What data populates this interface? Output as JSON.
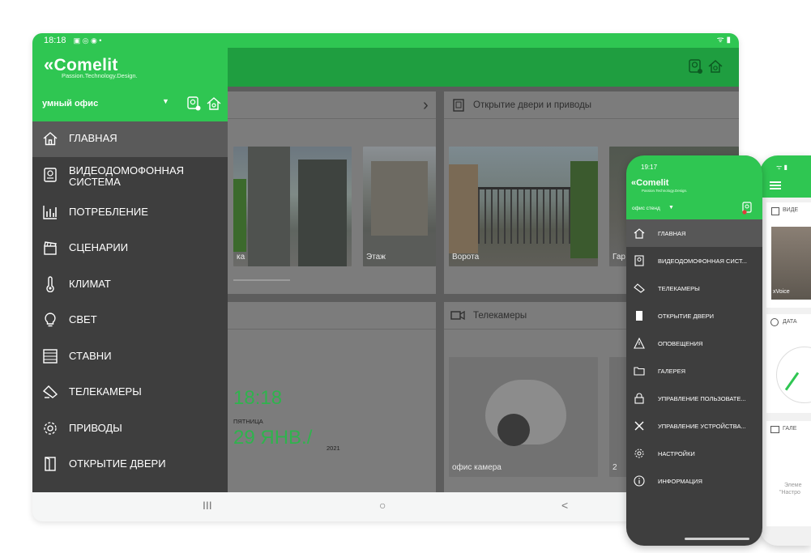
{
  "tablet": {
    "status_time": "18:18",
    "status_icons": "▣ ◎ ◉ •",
    "status_right": "ᯤ ▮",
    "brand": "Comelit",
    "brand_mark": "«",
    "tagline": "Passion.Technology.Design.",
    "office": "умный офис",
    "menu": [
      {
        "label": "ГЛАВНАЯ",
        "icon": "home-icon",
        "active": true
      },
      {
        "label": "ВИДЕОДОМОФОННАЯ СИСТЕМА",
        "icon": "intercom-icon"
      },
      {
        "label": "ПОТРЕБЛЕНИЕ",
        "icon": "chart-icon"
      },
      {
        "label": "СЦЕНАРИИ",
        "icon": "clapperboard-icon"
      },
      {
        "label": "КЛИМАТ",
        "icon": "thermometer-icon"
      },
      {
        "label": "СВЕТ",
        "icon": "bulb-icon"
      },
      {
        "label": "СТАВНИ",
        "icon": "shutter-icon"
      },
      {
        "label": "ТЕЛЕКАМЕРЫ",
        "icon": "camera-icon"
      },
      {
        "label": "ПРИВОДЫ",
        "icon": "gear-icon"
      },
      {
        "label": "ОТКРЫТИЕ ДВЕРИ",
        "icon": "door-icon"
      }
    ],
    "cards": {
      "door_title": "Открытие двери и приводы",
      "cams_title": "Телекамеры",
      "thumbs_top": [
        "ка",
        "Этаж",
        "Ворота",
        "Гар"
      ],
      "thumbs_cams": [
        "офис камера",
        "2"
      ],
      "clock_time": "18:18",
      "clock_day": "ПЯТНИЦА",
      "clock_date": "29 ЯНВ./",
      "clock_year": "2021"
    },
    "nav": {
      "recent": "III",
      "home": "○",
      "back": "<"
    }
  },
  "phone": {
    "time": "19:17",
    "brand": "Comelit",
    "brand_mark": "«",
    "tagline": "Passion.Technology.Design.",
    "office": "офис стенд",
    "menu": [
      {
        "label": "ГЛАВНАЯ",
        "icon": "home-icon",
        "active": true
      },
      {
        "label": "ВИДЕОДОМОФОННАЯ СИСТ...",
        "icon": "intercom-icon"
      },
      {
        "label": "ТЕЛЕКАМЕРЫ",
        "icon": "camera-icon"
      },
      {
        "label": "ОТКРЫТИЕ ДВЕРИ",
        "icon": "door-icon"
      },
      {
        "label": "ОПОВЕЩЕНИЯ",
        "icon": "warning-icon"
      },
      {
        "label": "ГАЛЕРЕЯ",
        "icon": "folder-icon"
      },
      {
        "label": "УПРАВЛЕНИЕ ПОЛЬЗОВАТЕ...",
        "icon": "lock-icon"
      },
      {
        "label": "УПРАВЛЕНИЕ УСТРОЙСТВА...",
        "icon": "tools-icon"
      },
      {
        "label": "НАСТРОЙКИ",
        "icon": "gear-icon"
      },
      {
        "label": "ИНФОРМАЦИЯ",
        "icon": "info-icon"
      }
    ]
  },
  "phone2": {
    "status": "ᯤ ▮",
    "section1": "ВИДЕ",
    "thumb_label": "xVoice",
    "section2": "ДАТА",
    "section3": "ГАЛЕ",
    "empty_line1": "Элеме",
    "empty_line2": "\"Настро"
  },
  "colors": {
    "green": "#2fc652",
    "dark_green": "#1f9e40",
    "drawer": "#3e3e3e",
    "accent_text": "#2fb34d"
  }
}
